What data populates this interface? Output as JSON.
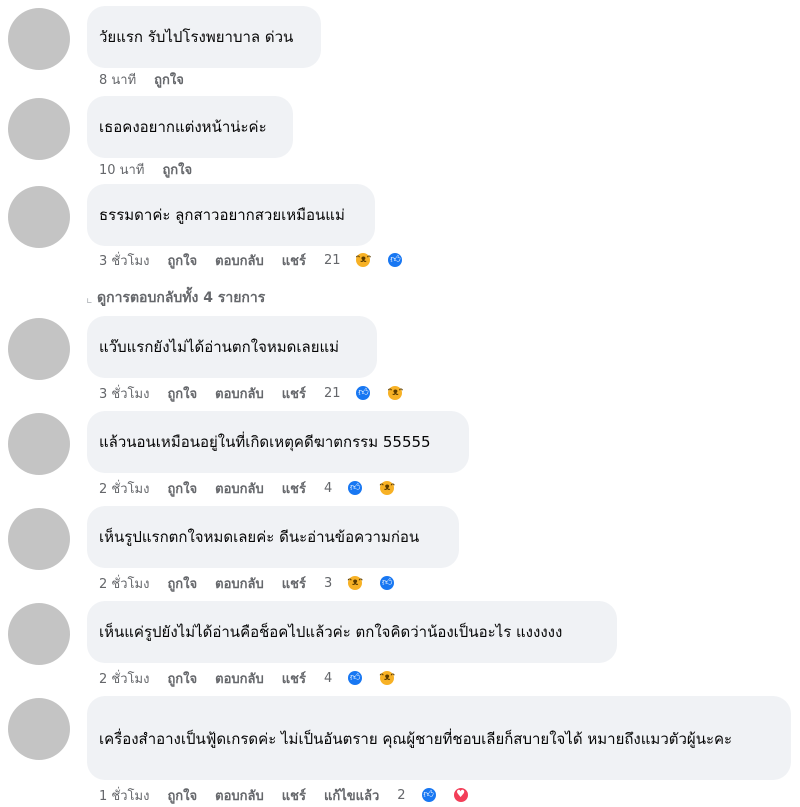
{
  "comments": [
    {
      "text": "วัยแรก รับไปโรงพยาบาล ด่วน",
      "time": "8 นาที",
      "like": "ถูกใจ",
      "reply": "",
      "share": "",
      "edited": "",
      "count": "",
      "emojis": []
    },
    {
      "text": "เธอคงอยากแต่งหน้าน่ะค่ะ",
      "time": "10 นาที",
      "like": "ถูกใจ",
      "reply": "",
      "share": "",
      "edited": "",
      "count": "",
      "emojis": []
    },
    {
      "text": "ธรรมดาค่ะ ลูกสาวอยากสวยเหมือนแม่",
      "time": "3 ชั่วโมง",
      "like": "ถูกใจ",
      "reply": "ตอบกลับ",
      "share": "แชร์",
      "edited": "",
      "count": "21",
      "emojis": [
        "haha",
        "like"
      ]
    },
    {
      "text": "แว๊บแรกยังไม่ได้อ่านตกใจหมดเลยแม่",
      "time": "3 ชั่วโมง",
      "like": "ถูกใจ",
      "reply": "ตอบกลับ",
      "share": "แชร์",
      "edited": "",
      "count": "21",
      "emojis": [
        "like",
        "haha"
      ]
    },
    {
      "text": "แล้วนอนเหมือนอยู่ในที่เกิดเหตุคดีฆาตกรรม 55555",
      "time": "2 ชั่วโมง",
      "like": "ถูกใจ",
      "reply": "ตอบกลับ",
      "share": "แชร์",
      "edited": "",
      "count": "4",
      "emojis": [
        "like",
        "haha"
      ]
    },
    {
      "text": "เห็นรูปแรกตกใจหมดเลยค่ะ ดีนะอ่านข้อความก่อน",
      "time": "2 ชั่วโมง",
      "like": "ถูกใจ",
      "reply": "ตอบกลับ",
      "share": "แชร์",
      "edited": "",
      "count": "3",
      "emojis": [
        "haha",
        "like"
      ]
    },
    {
      "text": "เห็นแค่รูปยังไม่ได้อ่านคือช็อคไปแล้วค่ะ ตกใจคิดว่าน้องเป็นอะไร แงงงงง",
      "time": "2 ชั่วโมง",
      "like": "ถูกใจ",
      "reply": "ตอบกลับ",
      "share": "แชร์",
      "edited": "",
      "count": "4",
      "emojis": [
        "like",
        "haha"
      ]
    },
    {
      "text": "เครื่องสำอางเป็นฟู้ดเกรดค่ะ ไม่เป็นอันตราย คุณผู้ชายที่ชอบเลียก็สบายใจได้ หมายถึงแมวตัวผู้นะคะ",
      "time": "1 ชั่วโมง",
      "like": "ถูกใจ",
      "reply": "ตอบกลับ",
      "share": "แชร์",
      "edited": "แก้ไขแล้ว",
      "count": "2",
      "emojis": [
        "like",
        "love"
      ]
    }
  ],
  "view_replies": "ดูการตอบกลับทั้ง 4 รายการ",
  "colors": {
    "bubble": "#f0f2f5",
    "meta": "#65676b",
    "like": "#1877f2",
    "haha": "#f7b125",
    "love": "#f33e58"
  },
  "icons": {
    "like": "thumbs-up-icon",
    "haha": "laughing-face-icon",
    "love": "heart-icon"
  }
}
